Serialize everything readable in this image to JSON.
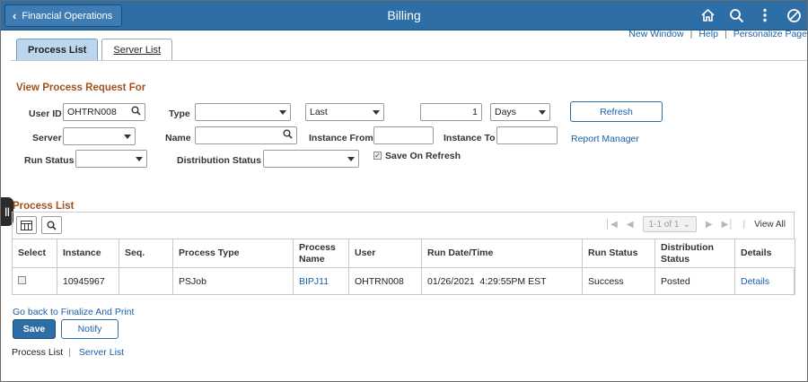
{
  "header": {
    "back_label": "Financial Operations",
    "title": "Billing",
    "icons": [
      "home-icon",
      "search-icon",
      "more-vertical-icon",
      "block-icon"
    ]
  },
  "toplinks": {
    "new_window": "New Window",
    "help": "Help",
    "personalize": "Personalize Page"
  },
  "tabs": [
    {
      "label": "Process List",
      "active": true
    },
    {
      "label": "Server List",
      "active": false
    }
  ],
  "form": {
    "section_title": "View Process Request For",
    "user_id_label": "User ID",
    "user_id_value": "OHTRN008",
    "type_label": "Type",
    "type_value": "",
    "range_value": "Last",
    "count_value": "1",
    "unit_value": "Days",
    "refresh_label": "Refresh",
    "server_label": "Server",
    "server_value": "",
    "name_label": "Name",
    "name_value": "",
    "instance_from_label": "Instance From",
    "instance_from_value": "",
    "instance_to_label": "Instance To",
    "instance_to_value": "",
    "report_manager_label": "Report Manager",
    "run_status_label": "Run Status",
    "run_status_value": "",
    "dist_status_label": "Distribution Status",
    "dist_status_value": "",
    "save_on_refresh_label": "Save On Refresh",
    "save_on_refresh_checked": true
  },
  "grid": {
    "title": "Process List",
    "pager_text": "1-1 of 1",
    "view_all": "View All",
    "columns": [
      "Select",
      "Instance",
      "Seq.",
      "Process Type",
      "Process Name",
      "User",
      "Run Date/Time",
      "Run Status",
      "Distribution Status",
      "Details"
    ],
    "rows": [
      {
        "select": false,
        "instance": "10945967",
        "seq": "",
        "process_type": "PSJob",
        "process_name": "BIPJ11",
        "user": "OHTRN008",
        "run_datetime": "01/26/2021  4:29:55PM EST",
        "run_status": "Success",
        "distribution_status": "Posted",
        "details": "Details"
      }
    ]
  },
  "actions": {
    "finalize_link": "Go back to Finalize And Print",
    "save_label": "Save",
    "notify_label": "Notify"
  },
  "footer": {
    "process_list": "Process List",
    "server_list": "Server List"
  },
  "colors": {
    "header_bg": "#2e6ea7",
    "section_title": "#a1521c",
    "link": "#1a5fa8",
    "active_tab": "#bcd6ee"
  }
}
